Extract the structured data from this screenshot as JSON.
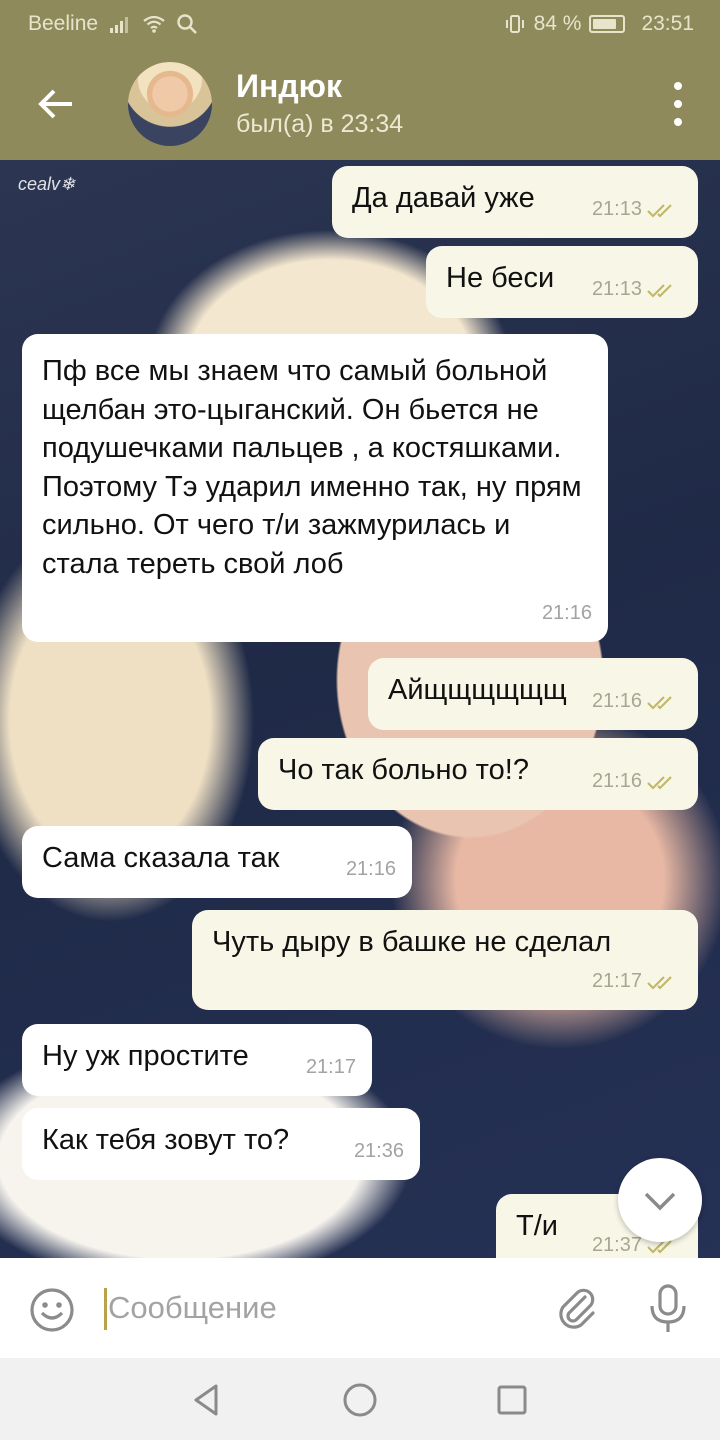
{
  "status_bar": {
    "carrier": "Beeline",
    "battery": "84 %",
    "battery_level": 0.84,
    "time": "23:51"
  },
  "header": {
    "name": "Индюк",
    "status": "был(а) в 23:34"
  },
  "watermark": "cealv❄",
  "messages": [
    {
      "side": "out",
      "text": "Да давай уже",
      "time": "21:13"
    },
    {
      "side": "out",
      "text": "Не беси",
      "time": "21:13"
    },
    {
      "side": "in",
      "text": "Пф все мы знаем что самый больной щелбан это-цыганский. Он бьется не подушечками пальцев , а костяшками. Поэтому Тэ ударил именно так, ну прям сильно. От чего т/и зажмурилась и стала тереть свой лоб",
      "time": "21:16"
    },
    {
      "side": "out",
      "text": "Айщщщщщщ",
      "time": "21:16"
    },
    {
      "side": "out",
      "text": "Чо так больно то!?",
      "time": "21:16"
    },
    {
      "side": "in",
      "text": "Сама сказала так",
      "time": "21:16"
    },
    {
      "side": "out",
      "text": "Чуть дыру в башке не сделал",
      "time": "21:17"
    },
    {
      "side": "in",
      "text": "Ну уж простите",
      "time": "21:17"
    },
    {
      "side": "in",
      "text": "Как тебя зовут то?",
      "time": "21:36"
    },
    {
      "side": "out",
      "text": "Т/и",
      "time": "21:37"
    }
  ],
  "composer": {
    "placeholder": "Сообщение"
  },
  "colors": {
    "header": "#8f8a5b",
    "out_bubble": "#f8f7e7",
    "in_bubble": "#ffffff",
    "check": "#c2b86a"
  }
}
